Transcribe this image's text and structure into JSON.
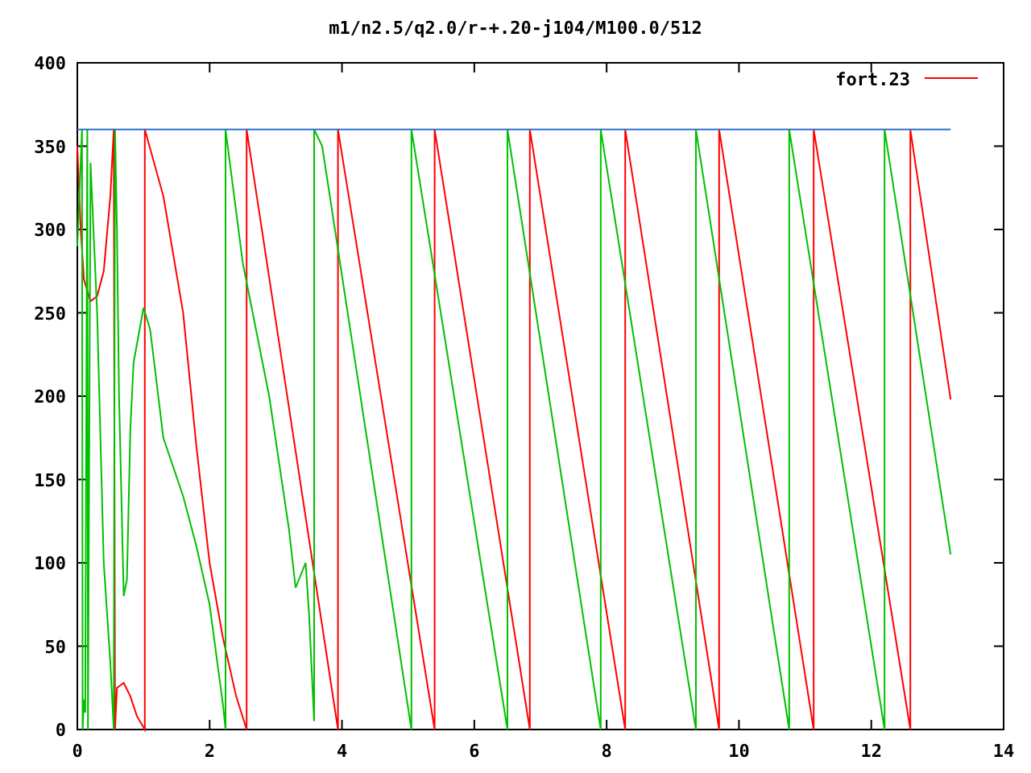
{
  "plot": {
    "chart_data": {
      "type": "line",
      "title": "m1/n2.5/q2.0/r-+.20-j104/M100.0/512",
      "xlim": [
        0,
        14
      ],
      "ylim": [
        0,
        400
      ],
      "xticks": [
        0,
        2,
        4,
        6,
        8,
        10,
        12,
        14
      ],
      "yticks": [
        0,
        50,
        100,
        150,
        200,
        250,
        300,
        350,
        400
      ],
      "series": [
        {
          "name": "fort.23",
          "color": "#ff0000",
          "x": [
            0,
            0.05,
            0.1,
            0.2,
            0.3,
            0.4,
            0.5,
            0.55,
            0.57,
            0.6,
            0.7,
            0.8,
            0.9,
            1.02,
            1.02,
            1.3,
            1.6,
            1.8,
            2.0,
            2.2,
            2.4,
            2.56,
            2.56,
            3.94,
            3.94,
            5.4,
            5.4,
            6.84,
            6.84,
            8.28,
            8.28,
            9.7,
            9.7,
            11.13,
            11.13,
            12.59,
            12.59,
            13.2
          ],
          "values": [
            350,
            300,
            270,
            257,
            260,
            275,
            320,
            360,
            0,
            25,
            28,
            20,
            8,
            0,
            360,
            320,
            250,
            170,
            100,
            55,
            20,
            0,
            360,
            0,
            360,
            0,
            360,
            0,
            360,
            0,
            360,
            0,
            360,
            0,
            360,
            0,
            360,
            198
          ]
        },
        {
          "color": "#00c000",
          "x": [
            0,
            0.07,
            0.08,
            0.1,
            0.12,
            0.15,
            0.16,
            0.2,
            0.3,
            0.4,
            0.5,
            0.55,
            0.57,
            0.6,
            0.63,
            0.7,
            0.75,
            0.8,
            0.85,
            1.0,
            1.1,
            1.3,
            1.6,
            1.8,
            2.0,
            2.15,
            2.2,
            2.24,
            2.24,
            2.5,
            2.9,
            3.2,
            3.3,
            3.45,
            3.5,
            3.58,
            3.58,
            3.7,
            5.05,
            5.05,
            6.5,
            6.5,
            7.91,
            7.91,
            9.35,
            9.35,
            10.76,
            10.76,
            12.2,
            12.2,
            13.2
          ],
          "values": [
            290,
            360,
            0,
            18,
            10,
            360,
            0,
            340,
            250,
            100,
            40,
            0,
            360,
            300,
            200,
            80,
            90,
            180,
            220,
            253,
            240,
            175,
            140,
            110,
            75,
            30,
            15,
            0,
            360,
            280,
            200,
            120,
            85,
            100,
            70,
            5,
            360,
            350,
            0,
            360,
            0,
            360,
            0,
            360,
            0,
            360,
            0,
            360,
            0,
            360,
            105
          ]
        },
        {
          "color": "#3070d0",
          "x": [
            0,
            13.2
          ],
          "values": [
            360,
            360
          ]
        }
      ]
    }
  }
}
